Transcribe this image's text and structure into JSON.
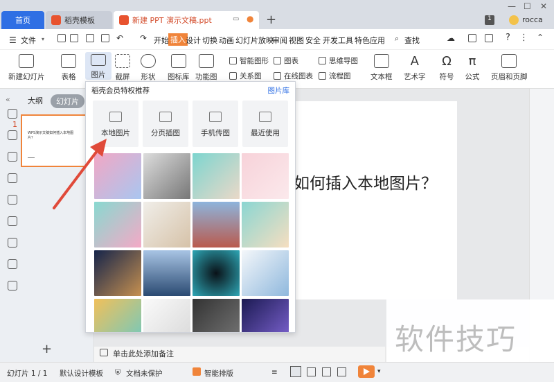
{
  "tabs": {
    "home": "首页",
    "template": "稻壳模板",
    "doc": "新建 PPT 演示文稿.ppt"
  },
  "window": {
    "badge": "1",
    "user": "rocca"
  },
  "menu": {
    "file": "文件",
    "items": [
      "开始",
      "插入",
      "设计",
      "切换",
      "动画",
      "幻灯片放映",
      "审阅",
      "视图",
      "安全",
      "开发工具",
      "特色应用"
    ],
    "search": "查找"
  },
  "ribbon": {
    "new_slide": "新建幻灯片",
    "table": "表格",
    "picture": "图片",
    "screenshot": "截屏",
    "shape": "形状",
    "icon_lib": "图标库",
    "function_chart": "功能图",
    "smart_shape": "智能图形",
    "chart": "图表",
    "mind_map": "思维导图",
    "relation": "关系图",
    "online_chart": "在线图表",
    "flow_chart": "流程图",
    "textbox": "文本框",
    "art_text": "艺术字",
    "symbol": "符号",
    "formula": "公式",
    "header_footer": "页眉和页脚"
  },
  "left_pane": {
    "outline": "大纲",
    "slides": "幻灯片",
    "slide_number": "1",
    "thumb_text": "WPS演示文稿如何插入本地图片？"
  },
  "slide": {
    "title": "WPS演示文稿如何插入本地图片？",
    "title_visible": "如何插入本地图片？"
  },
  "popup": {
    "title": "稻壳会员特权推荐",
    "library_link": "图片库",
    "sources": [
      "本地图片",
      "分页插图",
      "手机传图",
      "最近使用"
    ]
  },
  "notes": {
    "placeholder": "单击此处添加备注"
  },
  "status": {
    "slide_pos": "幻灯片 1 / 1",
    "theme": "默认设计模板",
    "protect": "文档未保护",
    "smart_layout": "智能排版"
  },
  "watermark": "软件技巧",
  "colors": {
    "accent_orange": "#f0843a",
    "home_tab_blue": "#2f6fe4",
    "doc_tab_text": "#d34b2a",
    "arrow_red": "#e04a3a"
  }
}
